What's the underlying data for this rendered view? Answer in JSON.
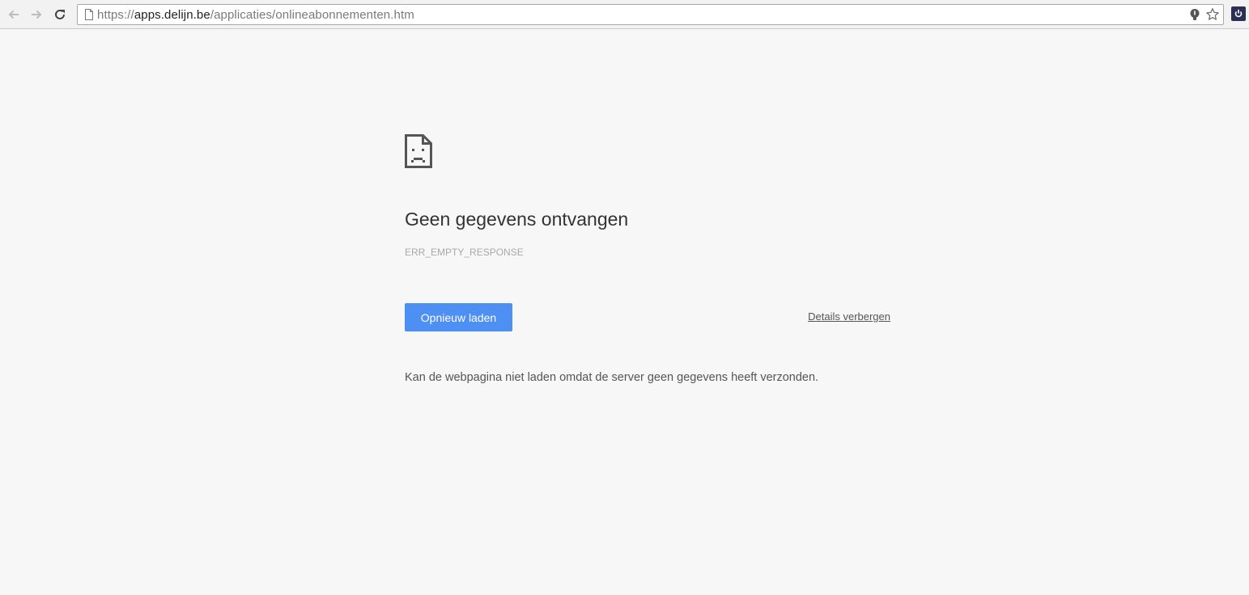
{
  "browser": {
    "url_scheme": "https://",
    "url_host": "apps.delijn.be",
    "url_path": "/applicaties/onlineabonnementen.htm",
    "icons": {
      "back": "arrow-left-icon",
      "forward": "arrow-right-icon",
      "reload": "reload-icon",
      "page": "page-icon",
      "bulb": "lightbulb-icon",
      "star": "star-icon",
      "extension": "power-icon"
    }
  },
  "error_page": {
    "icon": "sad-page-icon",
    "title": "Geen gegevens ontvangen",
    "error_code": "ERR_EMPTY_RESPONSE",
    "reload_label": "Opnieuw laden",
    "details_label": "Details verbergen",
    "details_text": "Kan de webpagina niet laden omdat de server geen gegevens heeft verzonden.",
    "colors": {
      "reload_button": "#4d8ff3",
      "background": "#f7f7f7"
    }
  }
}
